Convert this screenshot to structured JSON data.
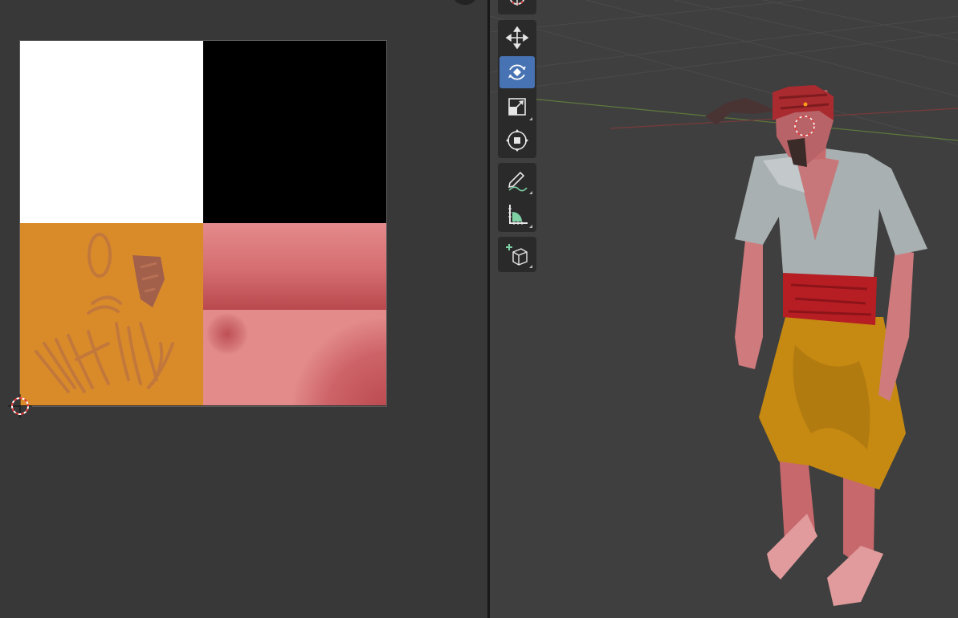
{
  "uv_editor": {
    "texture_regions": [
      "white",
      "black",
      "orange-clothing",
      "skin"
    ],
    "colors": {
      "white": "#ffffff",
      "black": "#000000",
      "orange": "#d98b2a",
      "skin": "#e38b8b",
      "skin_dark": "#b9484d"
    }
  },
  "viewport": {
    "tools": [
      {
        "name": "transform",
        "icon": "transform-icon"
      },
      {
        "name": "move",
        "icon": "move-icon"
      },
      {
        "name": "rotate",
        "icon": "rotate-icon",
        "active": true
      },
      {
        "name": "scale",
        "icon": "scale-icon"
      },
      {
        "name": "transform-all",
        "icon": "transform-all-icon"
      },
      {
        "name": "annotate",
        "icon": "annotate-icon"
      },
      {
        "name": "measure",
        "icon": "measure-icon"
      },
      {
        "name": "add-cube",
        "icon": "add-cube-icon"
      }
    ],
    "accent_color": "#4772b3",
    "model": {
      "shirt_color": "#a9b0b1",
      "pants_color": "#c68a12",
      "skin_color": "#d98e8e",
      "sash_color": "#b71e24"
    }
  }
}
